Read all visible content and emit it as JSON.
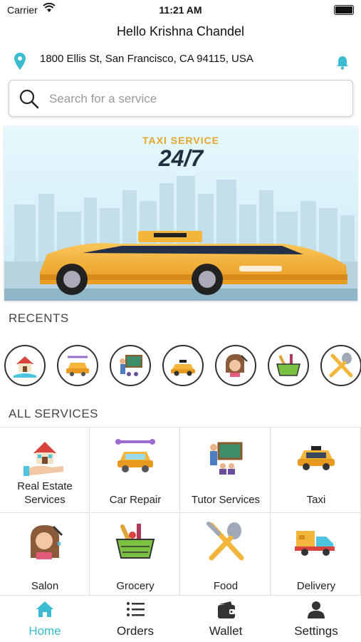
{
  "status_bar": {
    "carrier": "Carrier",
    "time": "11:21 AM"
  },
  "header": {
    "greeting": "Hello Krishna Chandel",
    "address": "1800 Ellis St, San Francisco, CA 94115, USA"
  },
  "search": {
    "placeholder": "Search for a service"
  },
  "banner": {
    "title": "TAXI SERVICE",
    "subtitle": "24/7"
  },
  "recents": {
    "title": "RECENTS",
    "items": [
      "real-estate-icon",
      "car-repair-icon",
      "tutor-icon",
      "taxi-icon",
      "salon-icon",
      "grocery-icon",
      "food-icon"
    ]
  },
  "services": {
    "title": "ALL SERVICES",
    "items": [
      {
        "label": "Real Estate Services",
        "icon": "real-estate-icon"
      },
      {
        "label": "Car Repair",
        "icon": "car-repair-icon"
      },
      {
        "label": "Tutor Services",
        "icon": "tutor-icon"
      },
      {
        "label": "Taxi",
        "icon": "taxi-icon"
      },
      {
        "label": "Salon",
        "icon": "salon-icon"
      },
      {
        "label": "Grocery",
        "icon": "grocery-icon"
      },
      {
        "label": "Food",
        "icon": "food-icon"
      },
      {
        "label": "Delivery",
        "icon": "delivery-truck-icon"
      }
    ]
  },
  "tabbar": {
    "items": [
      {
        "label": "Home",
        "icon": "home-icon",
        "active": true
      },
      {
        "label": "Orders",
        "icon": "list-icon",
        "active": false
      },
      {
        "label": "Wallet",
        "icon": "wallet-icon",
        "active": false
      },
      {
        "label": "Settings",
        "icon": "user-icon",
        "active": false
      }
    ]
  },
  "colors": {
    "accent": "#3bbcd0",
    "taxi_yellow": "#f4b63a",
    "banner_sky": "#dff4fb"
  }
}
